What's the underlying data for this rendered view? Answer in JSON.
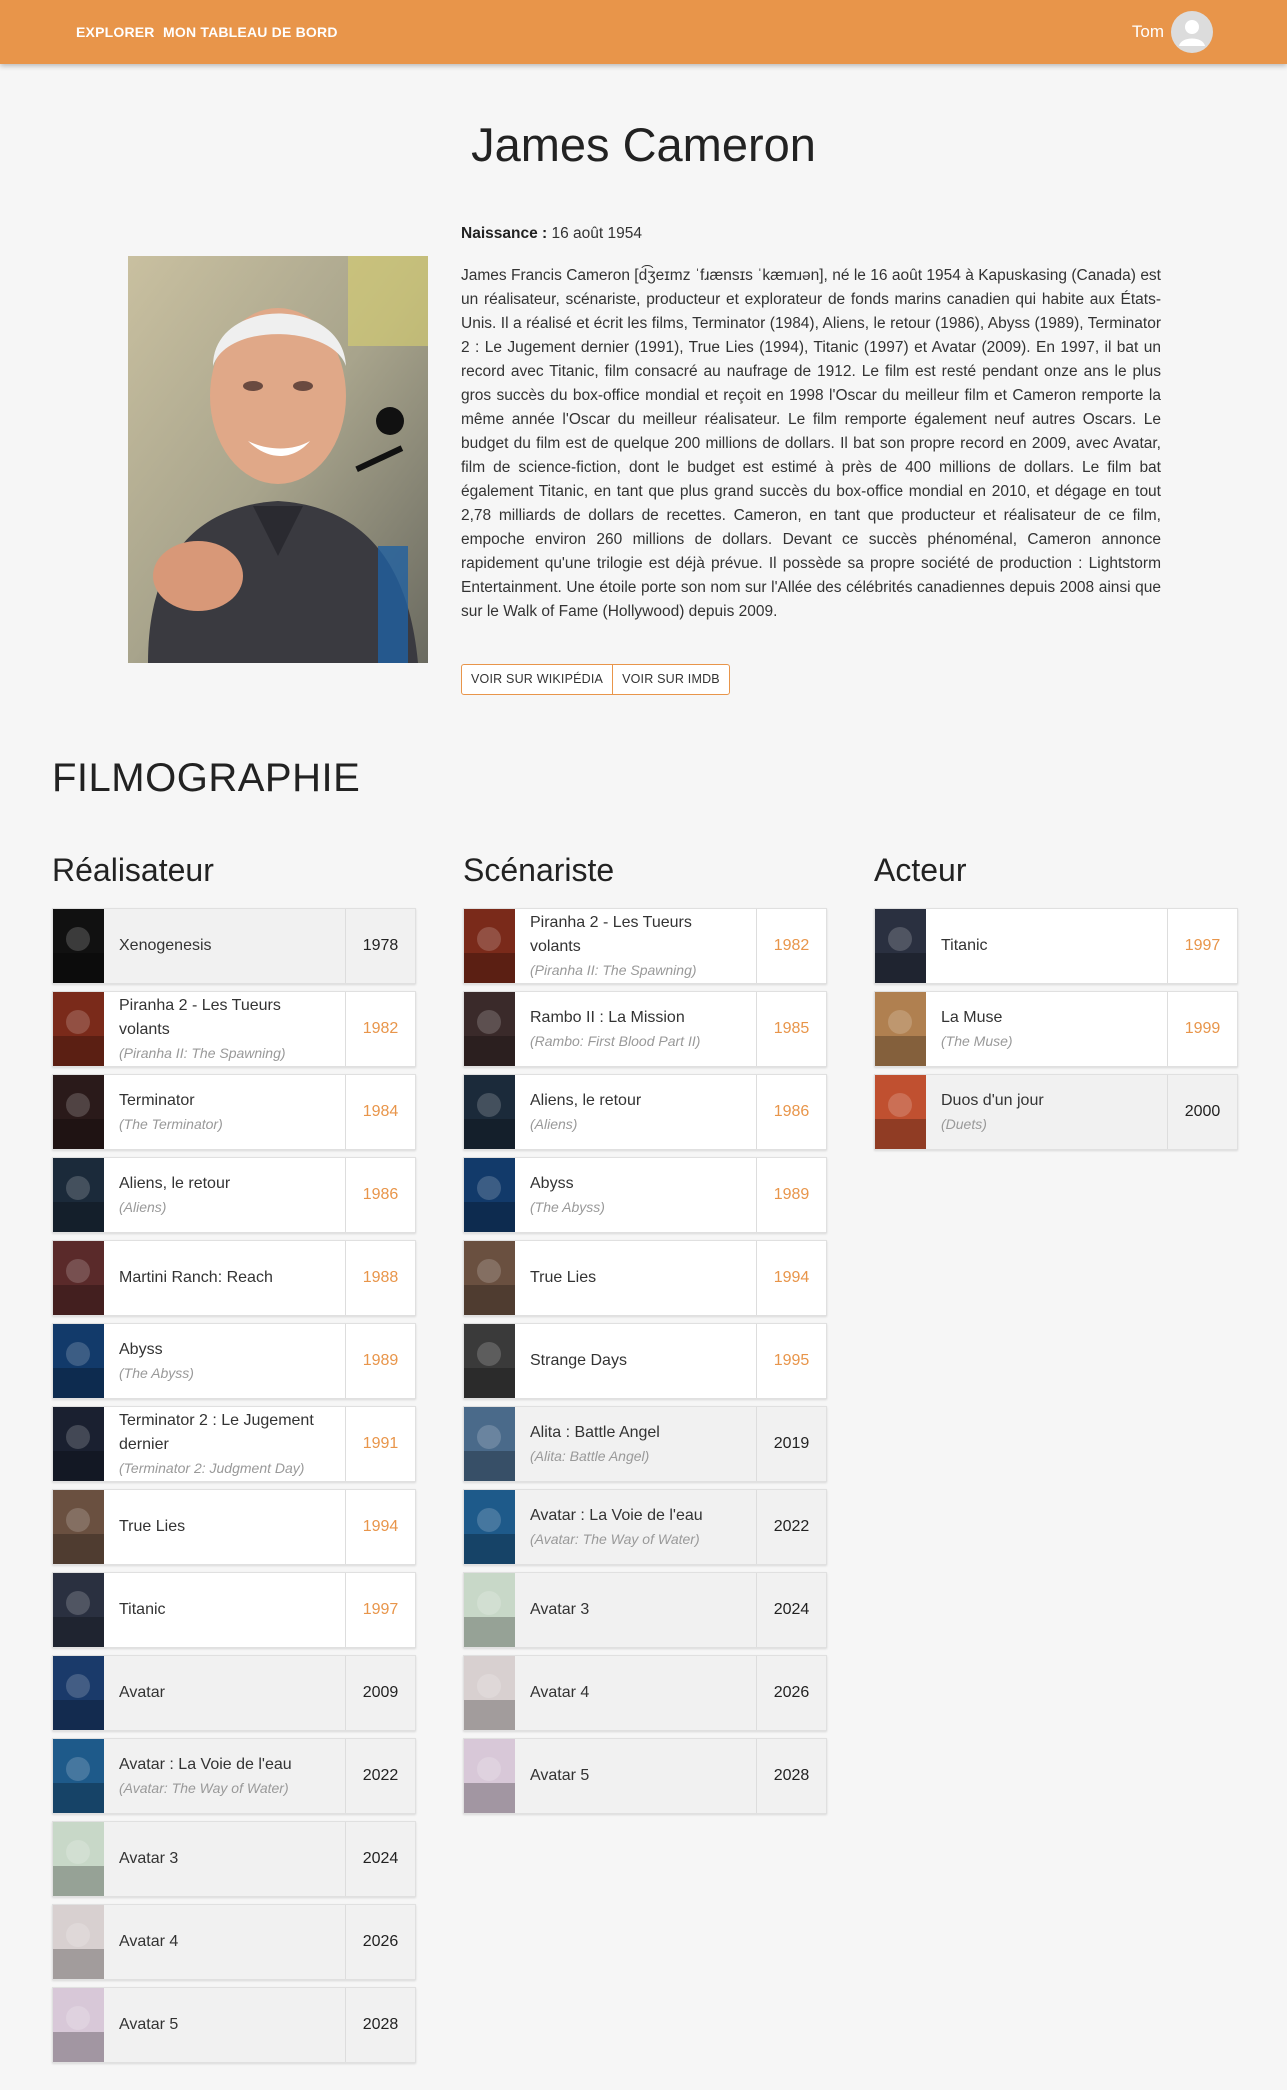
{
  "nav": {
    "explore": "EXPLORER",
    "dashboard": "MON TABLEAU DE BORD",
    "user_name": "Tom"
  },
  "person": {
    "name": "James Cameron",
    "birth_label": "Naissance :",
    "birth_value": "16 août 1954",
    "bio": "James Francis Cameron [d͡ʒeɪmz ˈfɹænsɪs ˈkæmɹən], né le 16 août 1954 à Kapuskasing (Canada) est un réalisateur, scénariste, producteur et explorateur de fonds marins canadien qui habite aux États-Unis. Il a réalisé et écrit les films, Terminator (1984), Aliens, le retour (1986), Abyss (1989), Terminator 2 : Le Jugement dernier (1991), True Lies (1994), Titanic (1997) et Avatar (2009). En 1997, il bat un record avec Titanic, film consacré au naufrage de 1912. Le film est resté pendant onze ans le plus gros succès du box-office mondial et reçoit en 1998 l'Oscar du meilleur film et Cameron remporte la même année l'Oscar du meilleur réalisateur. Le film remporte également neuf autres Oscars. Le budget du film est de quelque 200 millions de dollars. Il bat son propre record en 2009, avec Avatar, film de science-fiction, dont le budget est estimé à près de 400 millions de dollars. Le film bat également Titanic, en tant que plus grand succès du box-office mondial en 2010, et dégage en tout 2,78 milliards de dollars de recettes. Cameron, en tant que producteur et réalisateur de ce film, empoche environ 260 millions de dollars. Devant ce succès phénoménal, Cameron annonce rapidement qu'une trilogie est déjà prévue. Il possède sa propre société de production : Lightstorm Entertainment. Une étoile porte son nom sur l'Allée des célébrités canadiennes depuis 2008 ainsi que sur le Walk of Fame (Hollywood) depuis 2009.",
    "wiki_button": "VOIR SUR WIKIPÉDIA",
    "imdb_button": "VOIR SUR IMDB"
  },
  "filmography": {
    "title": "FILMOGRAPHIE",
    "columns": [
      {
        "title": "Réalisateur",
        "films": [
          {
            "title": "Xenogenesis",
            "original": "",
            "year": "1978",
            "seen": true,
            "poster": "#111111"
          },
          {
            "title": "Piranha 2 - Les Tueurs volants",
            "original": "(Piranha II: The Spawning)",
            "year": "1982",
            "seen": false,
            "poster": "#7a2a1a"
          },
          {
            "title": "Terminator",
            "original": "(The Terminator)",
            "year": "1984",
            "seen": false,
            "poster": "#2a1a1a"
          },
          {
            "title": "Aliens, le retour",
            "original": "(Aliens)",
            "year": "1986",
            "seen": false,
            "poster": "#1b2a3a"
          },
          {
            "title": "Martini Ranch: Reach",
            "original": "",
            "year": "1988",
            "seen": false,
            "poster": "#5a2a2a"
          },
          {
            "title": "Abyss",
            "original": "(The Abyss)",
            "year": "1989",
            "seen": false,
            "poster": "#123a6a"
          },
          {
            "title": "Terminator 2 : Le Jugement dernier",
            "original": "(Terminator 2: Judgment Day)",
            "year": "1991",
            "seen": false,
            "poster": "#1a2030"
          },
          {
            "title": "True Lies",
            "original": "",
            "year": "1994",
            "seen": false,
            "poster": "#6a5040"
          },
          {
            "title": "Titanic",
            "original": "",
            "year": "1997",
            "seen": false,
            "poster": "#2a3040"
          },
          {
            "title": "Avatar",
            "original": "",
            "year": "2009",
            "seen": true,
            "poster": "#1a3a6a"
          },
          {
            "title": "Avatar : La Voie de l'eau",
            "original": "(Avatar: The Way of Water)",
            "year": "2022",
            "seen": true,
            "poster": "#1e5a8a"
          },
          {
            "title": "Avatar 3",
            "original": "",
            "year": "2024",
            "seen": true,
            "poster": "#c8d8c8"
          },
          {
            "title": "Avatar 4",
            "original": "",
            "year": "2026",
            "seen": true,
            "poster": "#d8d0d0"
          },
          {
            "title": "Avatar 5",
            "original": "",
            "year": "2028",
            "seen": true,
            "poster": "#d8c8d8"
          }
        ]
      },
      {
        "title": "Scénariste",
        "films": [
          {
            "title": "Piranha 2 - Les Tueurs volants",
            "original": "(Piranha II: The Spawning)",
            "year": "1982",
            "seen": false,
            "poster": "#7a2a1a"
          },
          {
            "title": "Rambo II : La Mission",
            "original": "(Rambo: First Blood Part II)",
            "year": "1985",
            "seen": false,
            "poster": "#3a2a2a"
          },
          {
            "title": "Aliens, le retour",
            "original": "(Aliens)",
            "year": "1986",
            "seen": false,
            "poster": "#1b2a3a"
          },
          {
            "title": "Abyss",
            "original": "(The Abyss)",
            "year": "1989",
            "seen": false,
            "poster": "#123a6a"
          },
          {
            "title": "True Lies",
            "original": "",
            "year": "1994",
            "seen": false,
            "poster": "#6a5040"
          },
          {
            "title": "Strange Days",
            "original": "",
            "year": "1995",
            "seen": false,
            "poster": "#3a3a3a"
          },
          {
            "title": "Alita : Battle Angel",
            "original": "(Alita: Battle Angel)",
            "year": "2019",
            "seen": true,
            "poster": "#4a6a8a"
          },
          {
            "title": "Avatar : La Voie de l'eau",
            "original": "(Avatar: The Way of Water)",
            "year": "2022",
            "seen": true,
            "poster": "#1e5a8a"
          },
          {
            "title": "Avatar 3",
            "original": "",
            "year": "2024",
            "seen": true,
            "poster": "#c8d8c8"
          },
          {
            "title": "Avatar 4",
            "original": "",
            "year": "2026",
            "seen": true,
            "poster": "#d8d0d0"
          },
          {
            "title": "Avatar 5",
            "original": "",
            "year": "2028",
            "seen": true,
            "poster": "#d8c8d8"
          }
        ]
      },
      {
        "title": "Acteur",
        "films": [
          {
            "title": "Titanic",
            "original": "",
            "year": "1997",
            "seen": false,
            "poster": "#2a3040"
          },
          {
            "title": "La Muse",
            "original": "(The Muse)",
            "year": "1999",
            "seen": false,
            "poster": "#b08050"
          },
          {
            "title": "Duos d'un jour",
            "original": "(Duets)",
            "year": "2000",
            "seen": true,
            "poster": "#c05030"
          }
        ]
      }
    ]
  },
  "colors": {
    "accent": "#e8954a",
    "row_grey": "#f1f1f1"
  }
}
